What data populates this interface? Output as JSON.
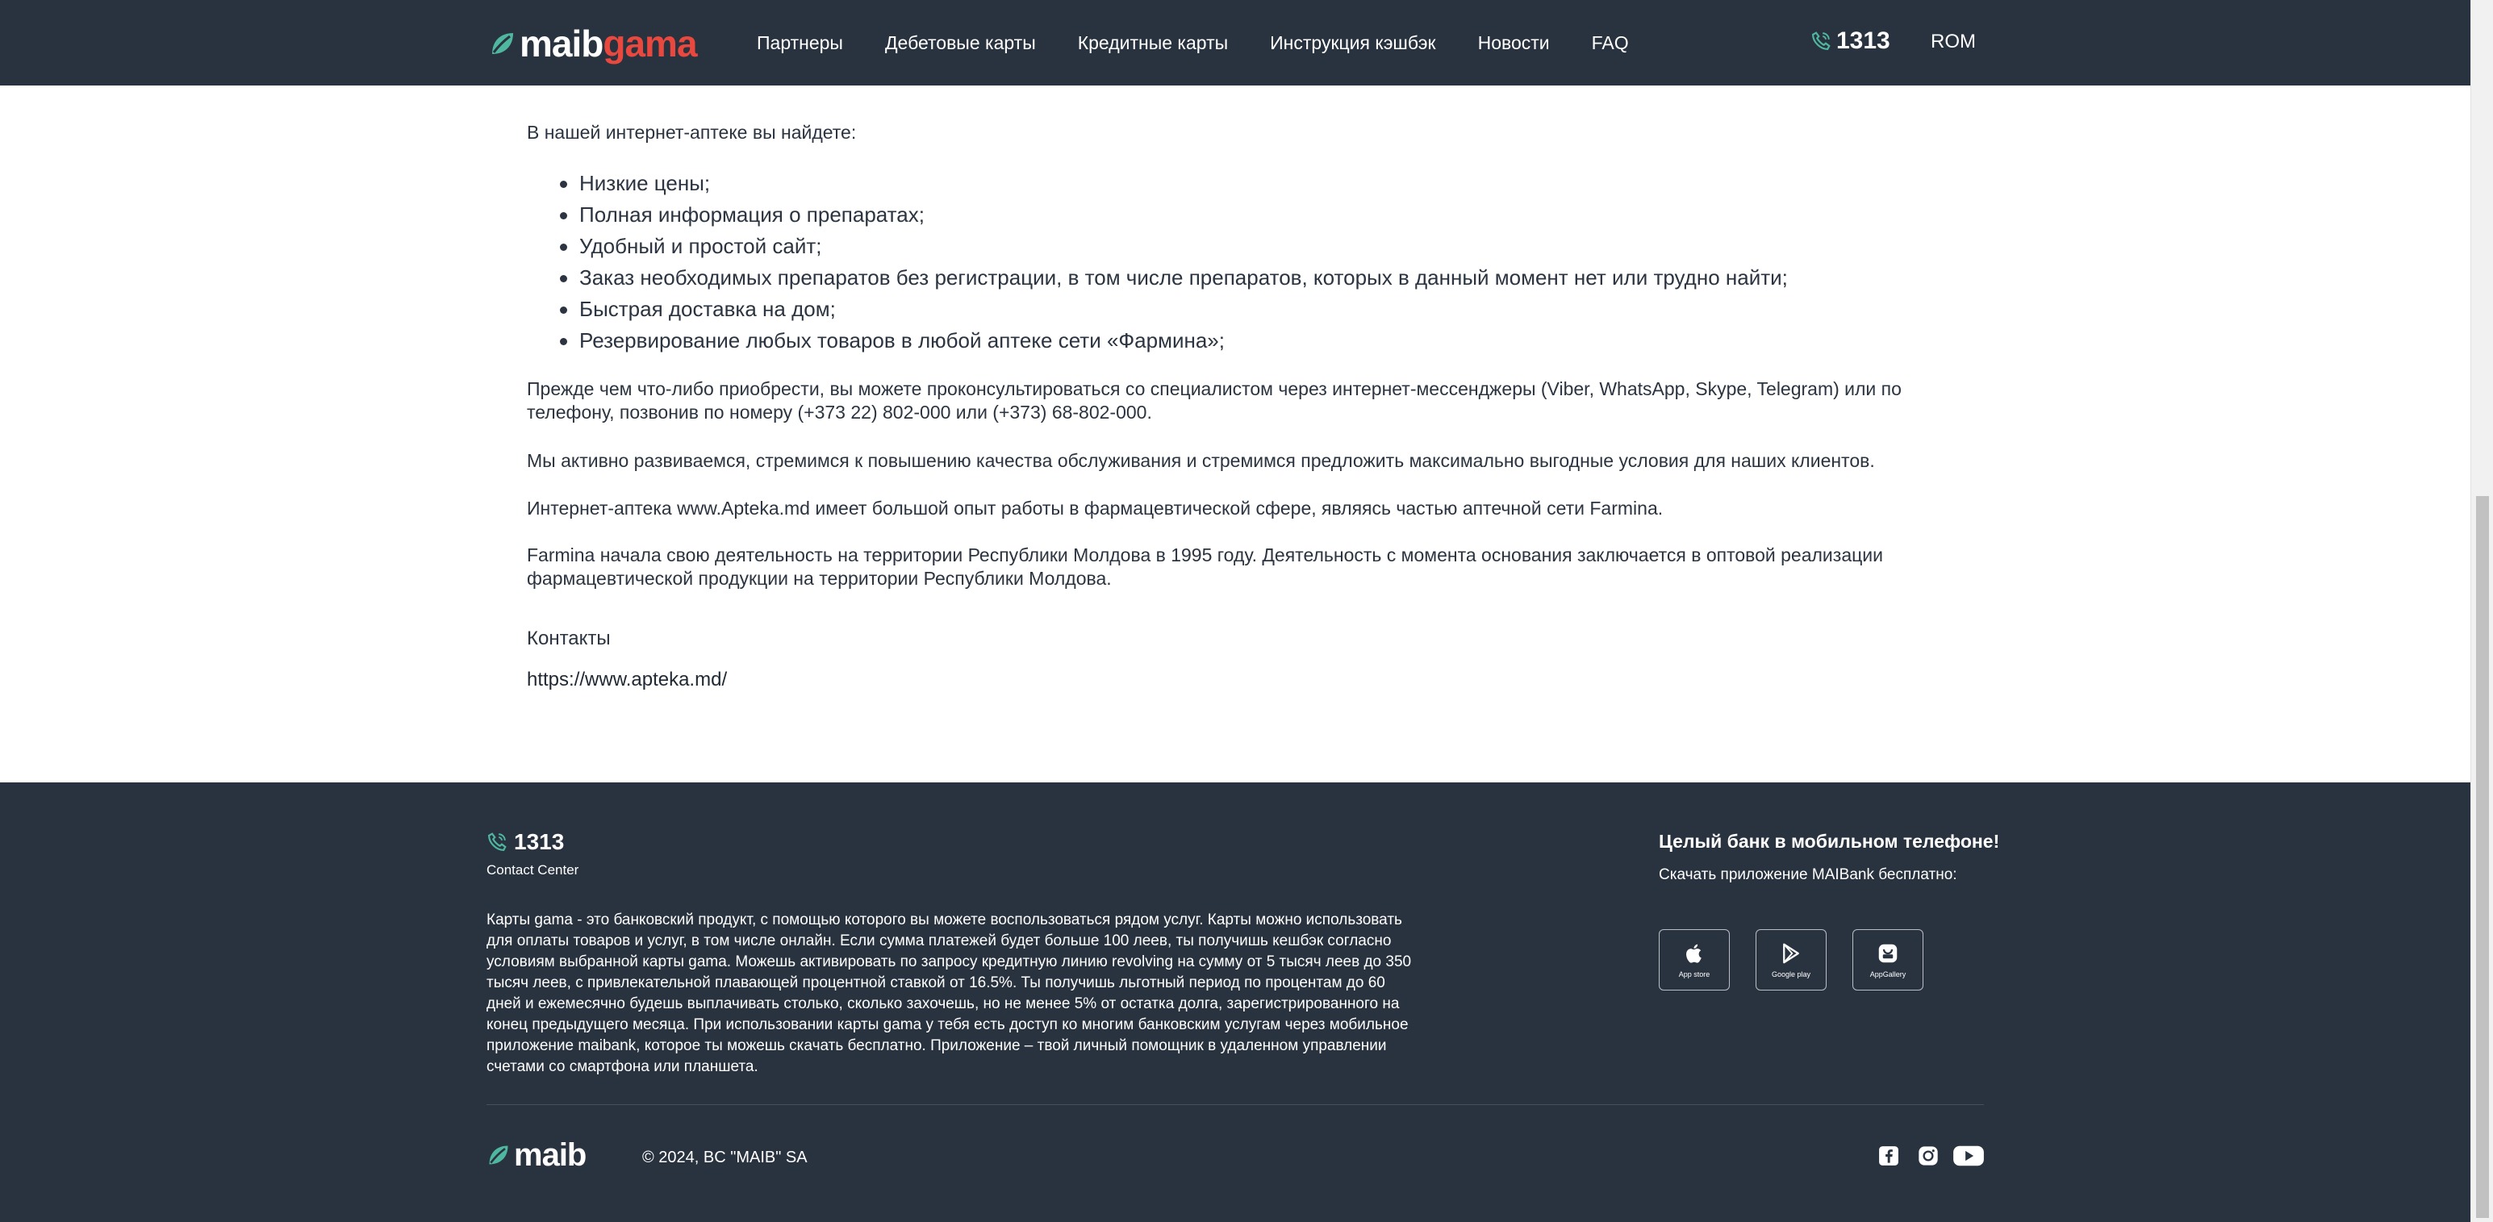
{
  "header": {
    "logo": {
      "part1": "maib",
      "part2": "gama"
    },
    "nav": [
      {
        "label": "Партнеры"
      },
      {
        "label": "Дебетовые карты"
      },
      {
        "label": "Кредитные карты"
      },
      {
        "label": "Инструкция кэшбэк"
      },
      {
        "label": "Новости"
      },
      {
        "label": "FAQ"
      }
    ],
    "phone": "1313",
    "language": "ROM"
  },
  "content": {
    "intro": "В нашей интернет-аптеке вы найдете:",
    "features": [
      "Низкие цены;",
      "Полная информация о препаратах;",
      "Удобный и простой сайт;",
      "Заказ необходимых препаратов без регистрации, в том числе препаратов, которых в данный момент нет или трудно найти;",
      "Быстрая доставка на дом;",
      "Резервирование любых товаров в любой аптеке сети «Фармина»;"
    ],
    "paragraph1": "Прежде чем что-либо приобрести, вы можете проконсультироваться со специалистом через интернет-мессенджеры (Viber, WhatsApp, Skype, Telegram) или по телефону, позвонив по номеру (+373 22) 802-000 или (+373) 68-802-000.",
    "paragraph2": "Мы активно развиваемся, стремимся к повышению качества обслуживания и стремимся предложить максимально выгодные условия для наших клиентов.",
    "paragraph3": "Интернет-аптека www.Apteka.md имеет большой опыт работы в фармацевтической сфере, являясь частью аптечной сети Farmina.",
    "paragraph4": "Farmina начала свою деятельность на территории Республики Молдова в 1995 году. Деятельность с момента основания заключается в оптовой реализации фармацевтической продукции на территории Республики Молдова.",
    "contacts_heading": "Контакты",
    "contacts_link": "https://www.apteka.md/"
  },
  "footer": {
    "phone": "1313",
    "contact_center": "Contact Center",
    "description": "Карты gama - это банковский продукт, с помощью которого вы можете воспользоваться рядом услуг. Карты можно использовать для оплаты товаров и услуг, в том числе онлайн. Если сумма платежей будет больше 100 леев, ты получишь кешбэк согласно условиям выбранной карты gama. Можешь активировать по запросу кредитную линию revolving на сумму от 5 тысяч леев до 350 тысяч леев, с привлекательной плавающей процентной ставкой от 16.5%. Ты получишь льготный период по процентам до 60 дней и ежемесячно будешь выплачивать столько, сколько захочешь, но не менее 5% от остатка долга, зарегистрированного на конец предыдущего месяца. При использовании карты gama у тебя есть доступ ко многим банковским услугам через мобильное приложение maibank, которое ты можешь скачать бесплатно. Приложение – твой личный помощник в удаленном управлении счетами со смартфона или планшета.",
    "app_title": "Целый банк в мобильном телефоне!",
    "app_subtitle": "Скачать приложение MAIBank бесплатно:",
    "stores": [
      {
        "label": "App store",
        "icon": "apple-icon"
      },
      {
        "label": "Google play",
        "icon": "google-play-icon"
      },
      {
        "label": "AppGallery",
        "icon": "huawei-appgallery-icon"
      }
    ],
    "logo": "maib",
    "copyright": "© 2024, BC \"MAIB\" SA",
    "social": [
      "facebook-icon",
      "instagram-icon",
      "youtube-icon"
    ]
  },
  "colors": {
    "header_bg": "#29323f",
    "footer_bg": "#29323f",
    "brand_green": "#4fb7a0",
    "brand_red": "#e8483e",
    "body_text": "#2b3440"
  }
}
